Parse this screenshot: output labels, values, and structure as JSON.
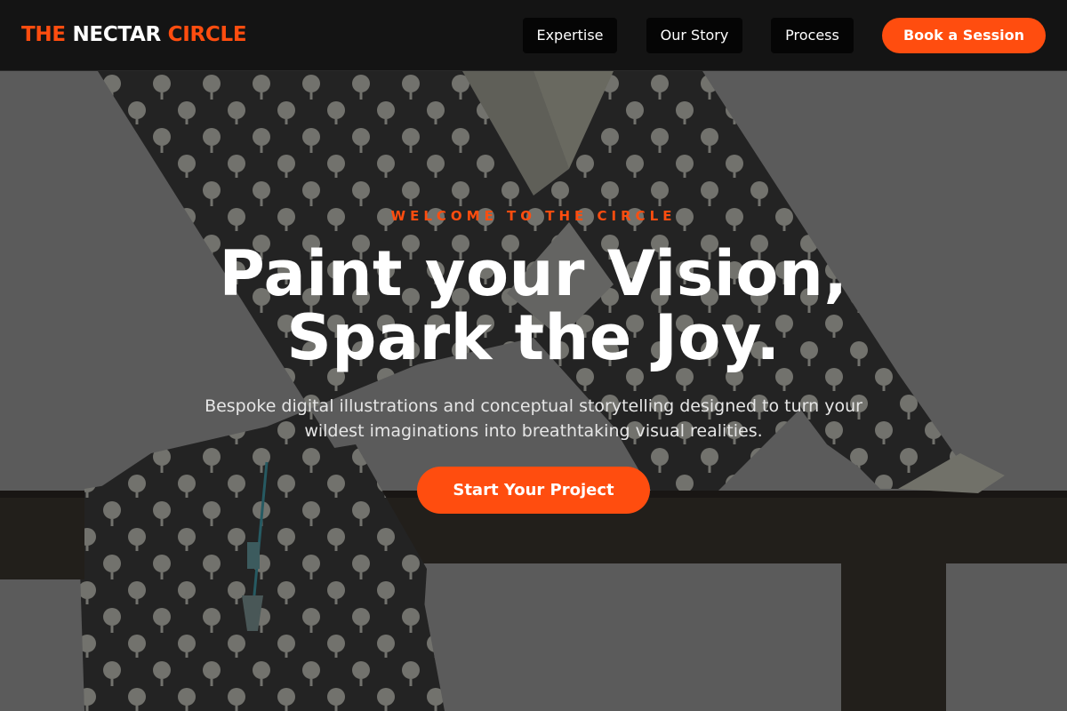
{
  "brand": {
    "word1": "THE",
    "word2": "NECTAR",
    "word3": "CIRCLE",
    "accent_color": "#ff4d0f"
  },
  "nav": {
    "links": [
      {
        "label": "Expertise"
      },
      {
        "label": "Our Story"
      },
      {
        "label": "Process"
      }
    ],
    "cta_label": "Book a Session"
  },
  "hero": {
    "eyebrow": "WELCOME TO THE CIRCLE",
    "headline_line1": "Paint your Vision,",
    "headline_line2": "Spark the Joy.",
    "subtext_line1": "Bespoke digital illustrations and conceptual storytelling designed to turn your",
    "subtext_line2": "wildest imaginations into breathtaking visual realities.",
    "cta_label": "Start Your Project",
    "background_description_icon": "illustration-image"
  }
}
